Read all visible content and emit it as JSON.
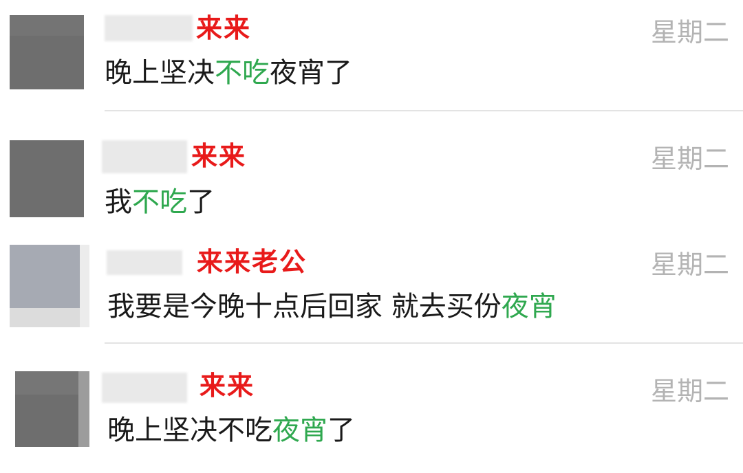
{
  "chats": [
    {
      "sender": "来来",
      "time": "星期二",
      "message": {
        "a": "晚上坚决",
        "b": "不吃",
        "c": "夜宵了"
      }
    },
    {
      "sender": "来来",
      "time": "星期二",
      "message": {
        "a": "我",
        "b": "不吃",
        "c": "了"
      }
    },
    {
      "sender": "来来老公",
      "time": "星期二",
      "message": {
        "a": "我要是今晚十点后回家 就去买份",
        "b": "夜宵",
        "c": ""
      }
    },
    {
      "sender": "来来",
      "time": "星期二",
      "message": {
        "a": "晚上坚决不吃",
        "b": "夜宵",
        "c": "了"
      }
    }
  ],
  "colors": {
    "sender": "#e81a1a",
    "highlight": "#2fa84f",
    "time": "#b3b3b3",
    "text": "#1a1a1a"
  }
}
